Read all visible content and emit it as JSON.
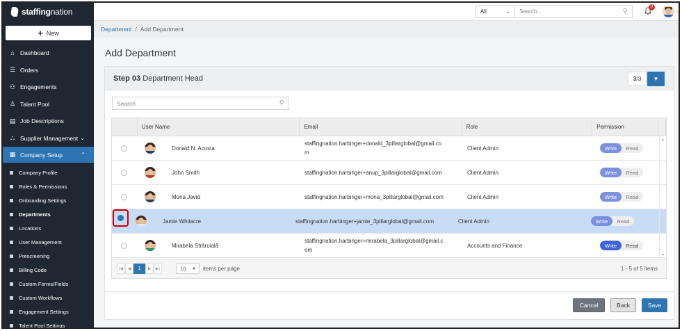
{
  "brand": {
    "name_bold": "staffing",
    "name_light": "nation"
  },
  "new_button": {
    "label": "New"
  },
  "nav": [
    {
      "id": "dashboard",
      "label": "Dashboard",
      "icon": "home-icon"
    },
    {
      "id": "orders",
      "label": "Orders",
      "icon": "list-icon"
    },
    {
      "id": "engagements",
      "label": "Engagements",
      "icon": "users-icon"
    },
    {
      "id": "talent-pool",
      "label": "Talent Pool",
      "icon": "user-icon"
    },
    {
      "id": "job-descriptions",
      "label": "Job Descriptions",
      "icon": "document-icon"
    },
    {
      "id": "supplier-management",
      "label": "Supplier Management",
      "icon": "hierarchy-icon"
    },
    {
      "id": "company-setup",
      "label": "Company Setup",
      "icon": "building-icon"
    }
  ],
  "sub_nav": [
    {
      "label": "Company Profile"
    },
    {
      "label": "Roles & Permissions"
    },
    {
      "label": "Onboarding Settings"
    },
    {
      "label": "Departments"
    },
    {
      "label": "Locations"
    },
    {
      "label": "User Management"
    },
    {
      "label": "Prescreening"
    },
    {
      "label": "Billing Code"
    },
    {
      "label": "Custom Forms/Fields"
    },
    {
      "label": "Custom Workflows"
    },
    {
      "label": "Engagement Settings"
    },
    {
      "label": "Talent Pool Settings"
    }
  ],
  "topbar": {
    "scope": "All",
    "search_placeholder": "Search...",
    "notification_count": "0"
  },
  "breadcrumb": {
    "parent": "Department",
    "separator": "/",
    "current": "Add Department"
  },
  "page_title": "Add Department",
  "step": {
    "number": "Step 03",
    "name": "Department Head",
    "current": "3",
    "total": "/3"
  },
  "grid_search_placeholder": "Search",
  "columns": {
    "user": "User Name",
    "email": "Email",
    "role": "Role",
    "permission": "Permission"
  },
  "rows": [
    {
      "name": "Donald N. Acosta",
      "email": "staffingnation.harbinger+donald_3pillarglobal@gmail.co\nm",
      "role": "Client Admin",
      "write": "Write",
      "read": "Read",
      "selected": false,
      "shirt": "#2b3f6b"
    },
    {
      "name": "John Smith",
      "email": "staffingnation.harbinger+anup_3pillarglobal@gmail.com",
      "role": "Client Admin",
      "write": "Write",
      "read": "Read",
      "selected": false,
      "shirt": "#c0392b"
    },
    {
      "name": "Mona Javid",
      "email": "staffingnation.harbinger+mona_3pillarglobal@gmail.com",
      "role": "Client Admin",
      "write": "Write",
      "read": "Read",
      "selected": false,
      "shirt": "#2c3e50"
    },
    {
      "name": "Jamie Whitacre",
      "email": "staffingnation.harbinger+jamie_3pillarglobal@gmail.com",
      "role": "Client Admin",
      "write": "Write",
      "read": "Read",
      "selected": true,
      "shirt": "#dfe6ee"
    },
    {
      "name": "Mirabela Străruială",
      "email": "staffingnation.harbinger+mirabela_3pillarglobal@gmail.c\nom",
      "role": "Accounts and Finance",
      "write": "Write",
      "read": "Read",
      "selected": false,
      "shirt": "#2d8a6e"
    }
  ],
  "pager": {
    "current_page": "1",
    "page_size": "10",
    "items_per_page": "items per page",
    "summary": "1 - 5 of 5 items"
  },
  "actions": {
    "cancel": "Cancel",
    "back": "Back",
    "save": "Save"
  },
  "colors": {
    "accent": "#2d74b3",
    "sidebar": "#1f2733",
    "selected_row": "#c9dcf5",
    "write_toggle": "#7b91e0"
  }
}
